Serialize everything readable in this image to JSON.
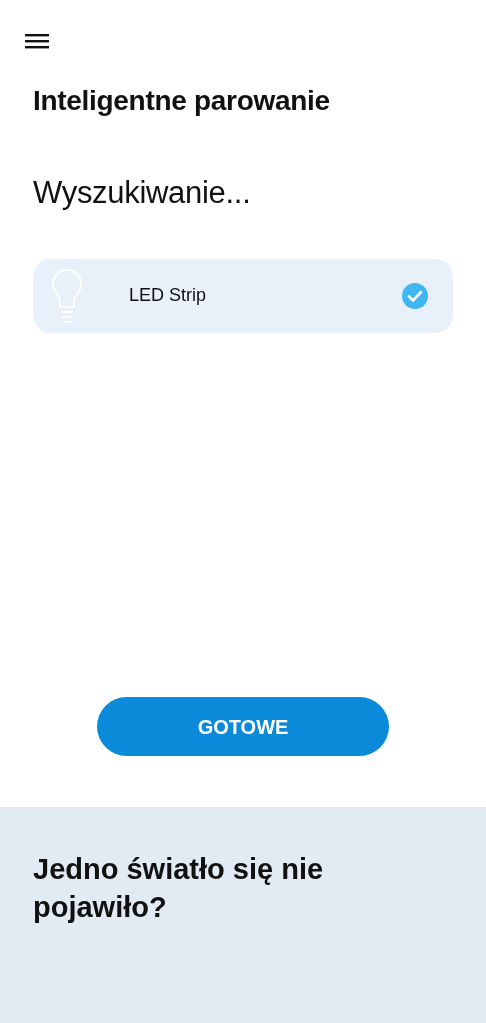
{
  "title": "Inteligentne parowanie",
  "status": "Wyszukiwanie...",
  "devices": [
    {
      "name": "LED Strip",
      "selected": true
    }
  ],
  "button": "GOTOWE",
  "help": {
    "title": "Jedno światło się nie pojawiło?"
  }
}
